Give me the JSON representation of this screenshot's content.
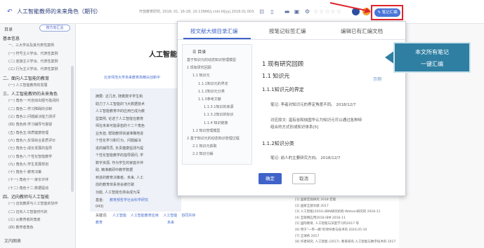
{
  "topbar": {
    "back_icon": "back-arrow-icon",
    "title": "人工智能教师的未来角色（期刊）",
    "meta": "开放教育研究, 2018, 01, 16-28, 10.13966/j.cnki.kfjyyj.2018.01.003",
    "stars": "☆☆☆☆☆",
    "merge_label": "笔记汇编",
    "accent": "#4a76d8",
    "highlight": "#e0232b"
  },
  "sidebar": {
    "tab_label": "目录",
    "toggle_label": "按方向汇总",
    "items": [
      {
        "label": "基本信息",
        "level": 1
      },
      {
        "label": "一、三大学派及其代表性案例",
        "level": 2
      },
      {
        "label": "(一) 符号主义学派、代表性案例",
        "level": 2
      },
      {
        "label": "(二) 连接主义学派、代表性案例",
        "level": 2
      },
      {
        "label": "(三) 行为主义学派、代表性案例",
        "level": 2
      },
      {
        "label": "二、面向人工智能的教育",
        "level": 1
      },
      {
        "label": "(一) 人工智能教育的发展",
        "level": 2
      },
      {
        "label": "三、人工智能教师的未来角色",
        "level": 1
      },
      {
        "label": "(一) 角色一:可自动出题与批阅的",
        "level": 2
      },
      {
        "label": "(二) 角色二:学习障碍的诊断",
        "level": 2
      },
      {
        "label": "(三) 角色三:问题解决能力测评",
        "level": 2
      },
      {
        "label": "(四) 角色四:学习辅导与答疑",
        "level": 2
      },
      {
        "label": "(五) 角色五:体质健康管理",
        "level": 2
      },
      {
        "label": "(六) 角色六:反馈综合素质评价",
        "level": 2
      },
      {
        "label": "(七) 角色七:成长发展的指导",
        "level": 2
      },
      {
        "label": "(八) 角色八:个性化智能教学",
        "level": 2
      },
      {
        "label": "(九) 角色九:学生发展规划",
        "level": 2
      },
      {
        "label": "(十) 角色十:教育决策",
        "level": 2
      },
      {
        "label": "(十一) 角色十一:家长伙伴",
        "level": 2
      },
      {
        "label": "(十二) 角色十二:数据驱动",
        "level": 2
      },
      {
        "label": "四、迈向教师与人工智能",
        "level": 1
      },
      {
        "label": "(一) 迈向教师与人工智能的协作",
        "level": 2
      },
      {
        "label": "(二) 迈向人工智能时代的",
        "level": 2
      },
      {
        "label": "(三) 从教育者的角度",
        "level": 2
      },
      {
        "label": "(四) 教育者角色",
        "level": 2
      }
    ],
    "footer": "文内图表"
  },
  "document": {
    "title": "人工智能教",
    "affiliation": "北京师范大学未来教育高精尖创新中",
    "abstract_label": "摘要:",
    "abstract_lines": [
      "近几年, 随着数字学生和",
      "助力了人工智能的飞大数据技术",
      "人工智能教育中的应用已成为教",
      "型案例, 论述了人工智能在教育",
      "师在未来可能承担的十二个角色",
      "业负担, 帮助教师快速准确地进",
      "个性化学习和行为、问题解决",
      "进的辅导员, 负责健康监测与提",
      "个性化智能教学的指导顾问, 学",
      "数字资源, 作为学生的家庭伙伴",
      "助, 精准教研中教学数据",
      "到进的教育决策者。未来, 人工",
      "前的教育体系将会被打破",
      "功能, 人工智能也将会成为深"
    ],
    "fund_label": "基金:",
    "fund_text": "教育部哲学社会科学研究",
    "fund_text2": "043)",
    "keywords_label": "关键词:",
    "keywords": [
      "人工智能",
      "人工智能教育应用",
      "人工智能",
      "协同共存",
      "未来",
      "教育"
    ]
  },
  "references": [
    "[1] 国家宏观研究 2018 宏观",
    "[2] 国家全部文献 2017",
    "[3] 人工智能(2016).BBN研究机构 Watson研究的 2016-11",
    "[4] 互联网应用2018 IBM 2016-11",
    "[5] 国际教育, 人工智能与深度学习的2017 等",
    "[6] 用于\"一带一路\"的领导者与技术的 2016.05-10",
    "[7] 全球各 2017",
    "[8] 作者研究, 人工智能 (2017). 教育研究.人工智能与数字技术的 2017"
  ],
  "modal": {
    "tabs": [
      "按文献大纲目录汇编",
      "按笔记标签汇编",
      "编辑已有汇编文档"
    ],
    "active_tab": 0,
    "toc_head": "目录",
    "toc": [
      {
        "label": "基于知识元的动态知识管理模型",
        "indent": 0
      },
      {
        "label": "1 现有研究回顾",
        "indent": 0
      },
      {
        "label": "1.1 知识元",
        "indent": 1
      },
      {
        "label": "1.1.1知识元的界定",
        "indent": 2
      },
      {
        "label": "1.1.2知识元分类",
        "indent": 2
      },
      {
        "label": "1.1.3参考文献",
        "indent": 2
      },
      {
        "label": "1.1.3.1知识的来源",
        "indent": 3
      },
      {
        "label": "1.1.3.2知识的标识",
        "indent": 3
      },
      {
        "label": "1.1.4 知识链接",
        "indent": 3
      },
      {
        "label": "1.2 知识管理模型",
        "indent": 1
      },
      {
        "label": "2 基于知识元的动态知识管理过程",
        "indent": 0
      },
      {
        "label": "2.1 知识元获取",
        "indent": 1
      },
      {
        "label": "2.2 知识分解",
        "indent": 1
      }
    ],
    "preview": {
      "h1": "1 现有研究回顾",
      "example_label": "示例",
      "h2": "1.1 知识元",
      "h3a": "1.1.1知识元的界定",
      "note1": "笔记: 李者对知识元的界定角度不同。 2018/12/7",
      "note2a": "对应原文: 温有谷和徐国华认为知识元可以通过各种特",
      "note2b": "组合的方式形成知识体系",
      "note2_sup": "[5]",
      "h3b": "1.1.2知识分类",
      "note3": "笔记: 前人的主要研究方向。 2018/12/7"
    },
    "ok_label": "确定",
    "cancel_label": "取消",
    "accent": "#3f63c8"
  },
  "callout": {
    "line1": "本文所有笔记",
    "line2": "一键汇编",
    "color": "#2f7fa3"
  }
}
